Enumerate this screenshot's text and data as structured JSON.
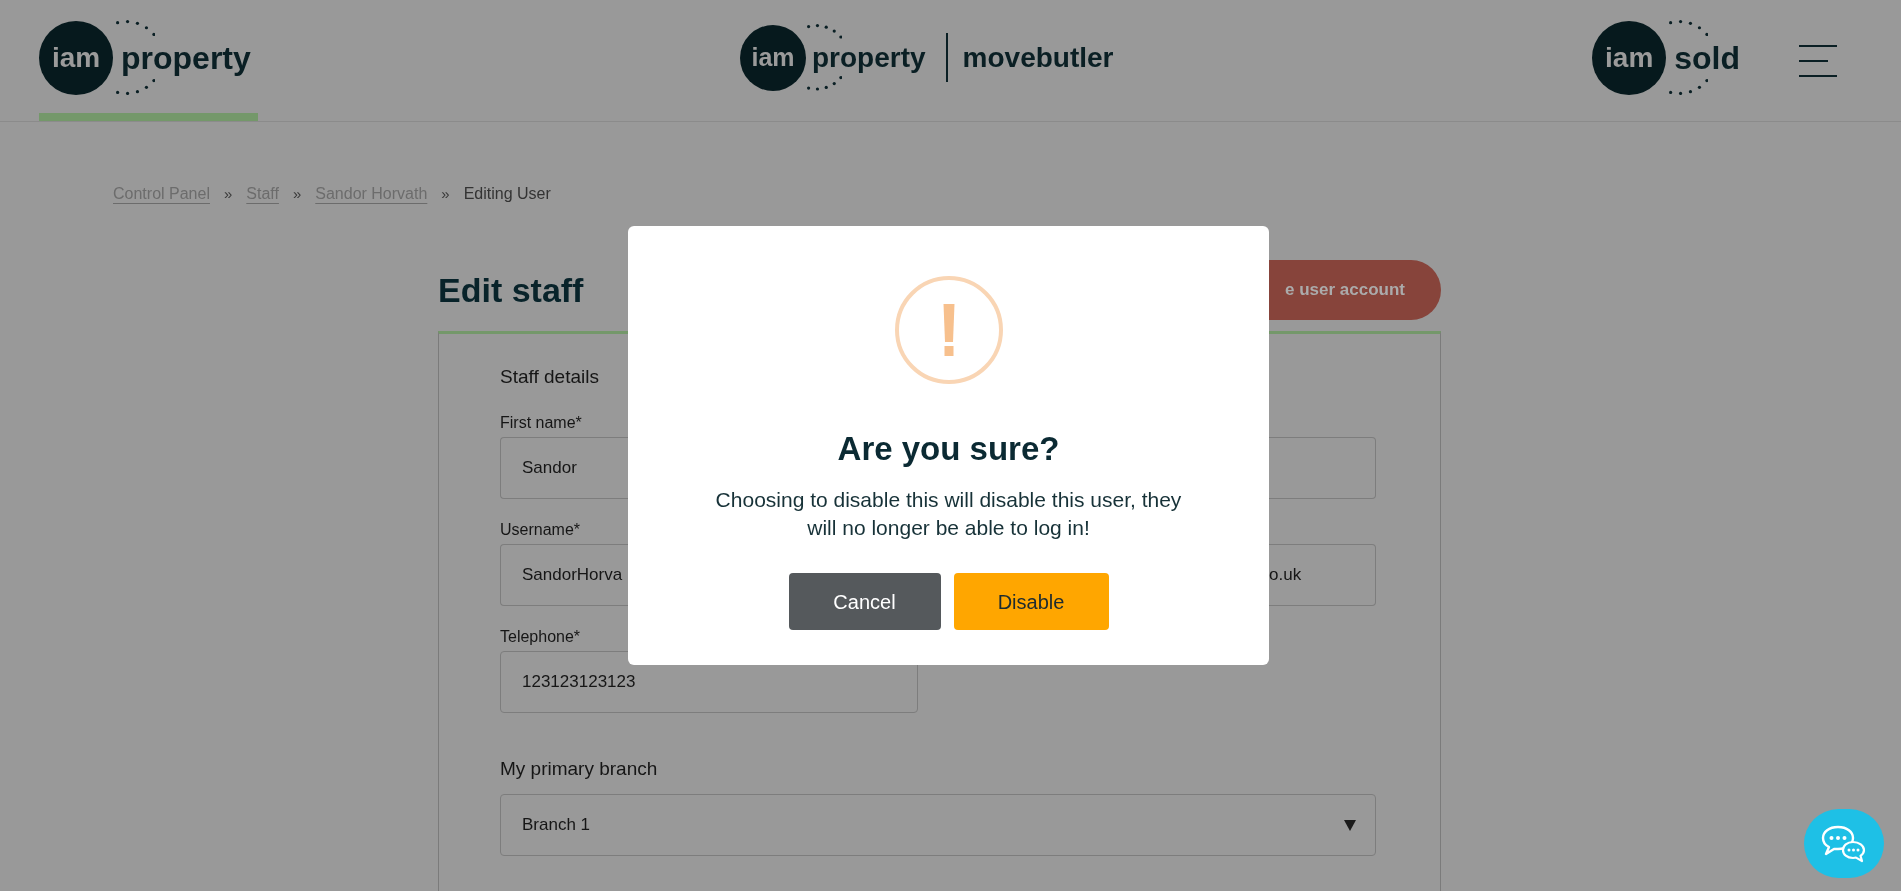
{
  "header": {
    "logos": [
      {
        "kind": "brand",
        "badge": "iam",
        "word": "property",
        "selected": true
      },
      {
        "kind": "cobrand",
        "badge": "iam",
        "word": "property",
        "partner": "movebutler",
        "selected": false
      },
      {
        "kind": "brand",
        "badge": "iam",
        "word": "sold",
        "selected": false
      }
    ]
  },
  "breadcrumb": {
    "items": [
      {
        "kind": "link",
        "label": "Control Panel"
      },
      {
        "kind": "link",
        "label": "Staff"
      },
      {
        "kind": "link",
        "label": "Sandor Horvath"
      },
      {
        "kind": "current",
        "label": "Editing User"
      }
    ],
    "separators": [
      "»",
      "»",
      "»"
    ]
  },
  "page": {
    "title": "Edit staff",
    "action_button": {
      "label": "e user account"
    }
  },
  "form": {
    "section_title": "Staff details",
    "fields": [
      {
        "kind": "pair",
        "label": "First name*",
        "value": "Sandor"
      },
      {
        "kind": "pair",
        "label": "Username*",
        "value": "SandorHorva",
        "right_value": "o.uk"
      },
      {
        "kind": "single",
        "label": "Telephone*",
        "value": "123123123123"
      }
    ],
    "branch": {
      "label": "My primary branch",
      "value": "Branch 1"
    }
  },
  "dialog": {
    "title": "Are you sure?",
    "message": "Choosing to disable this will disable this user, they will no longer be able to log in!",
    "buttons": [
      {
        "kind": "secondary",
        "label": "Cancel"
      },
      {
        "kind": "primary",
        "label": "Disable"
      }
    ]
  }
}
